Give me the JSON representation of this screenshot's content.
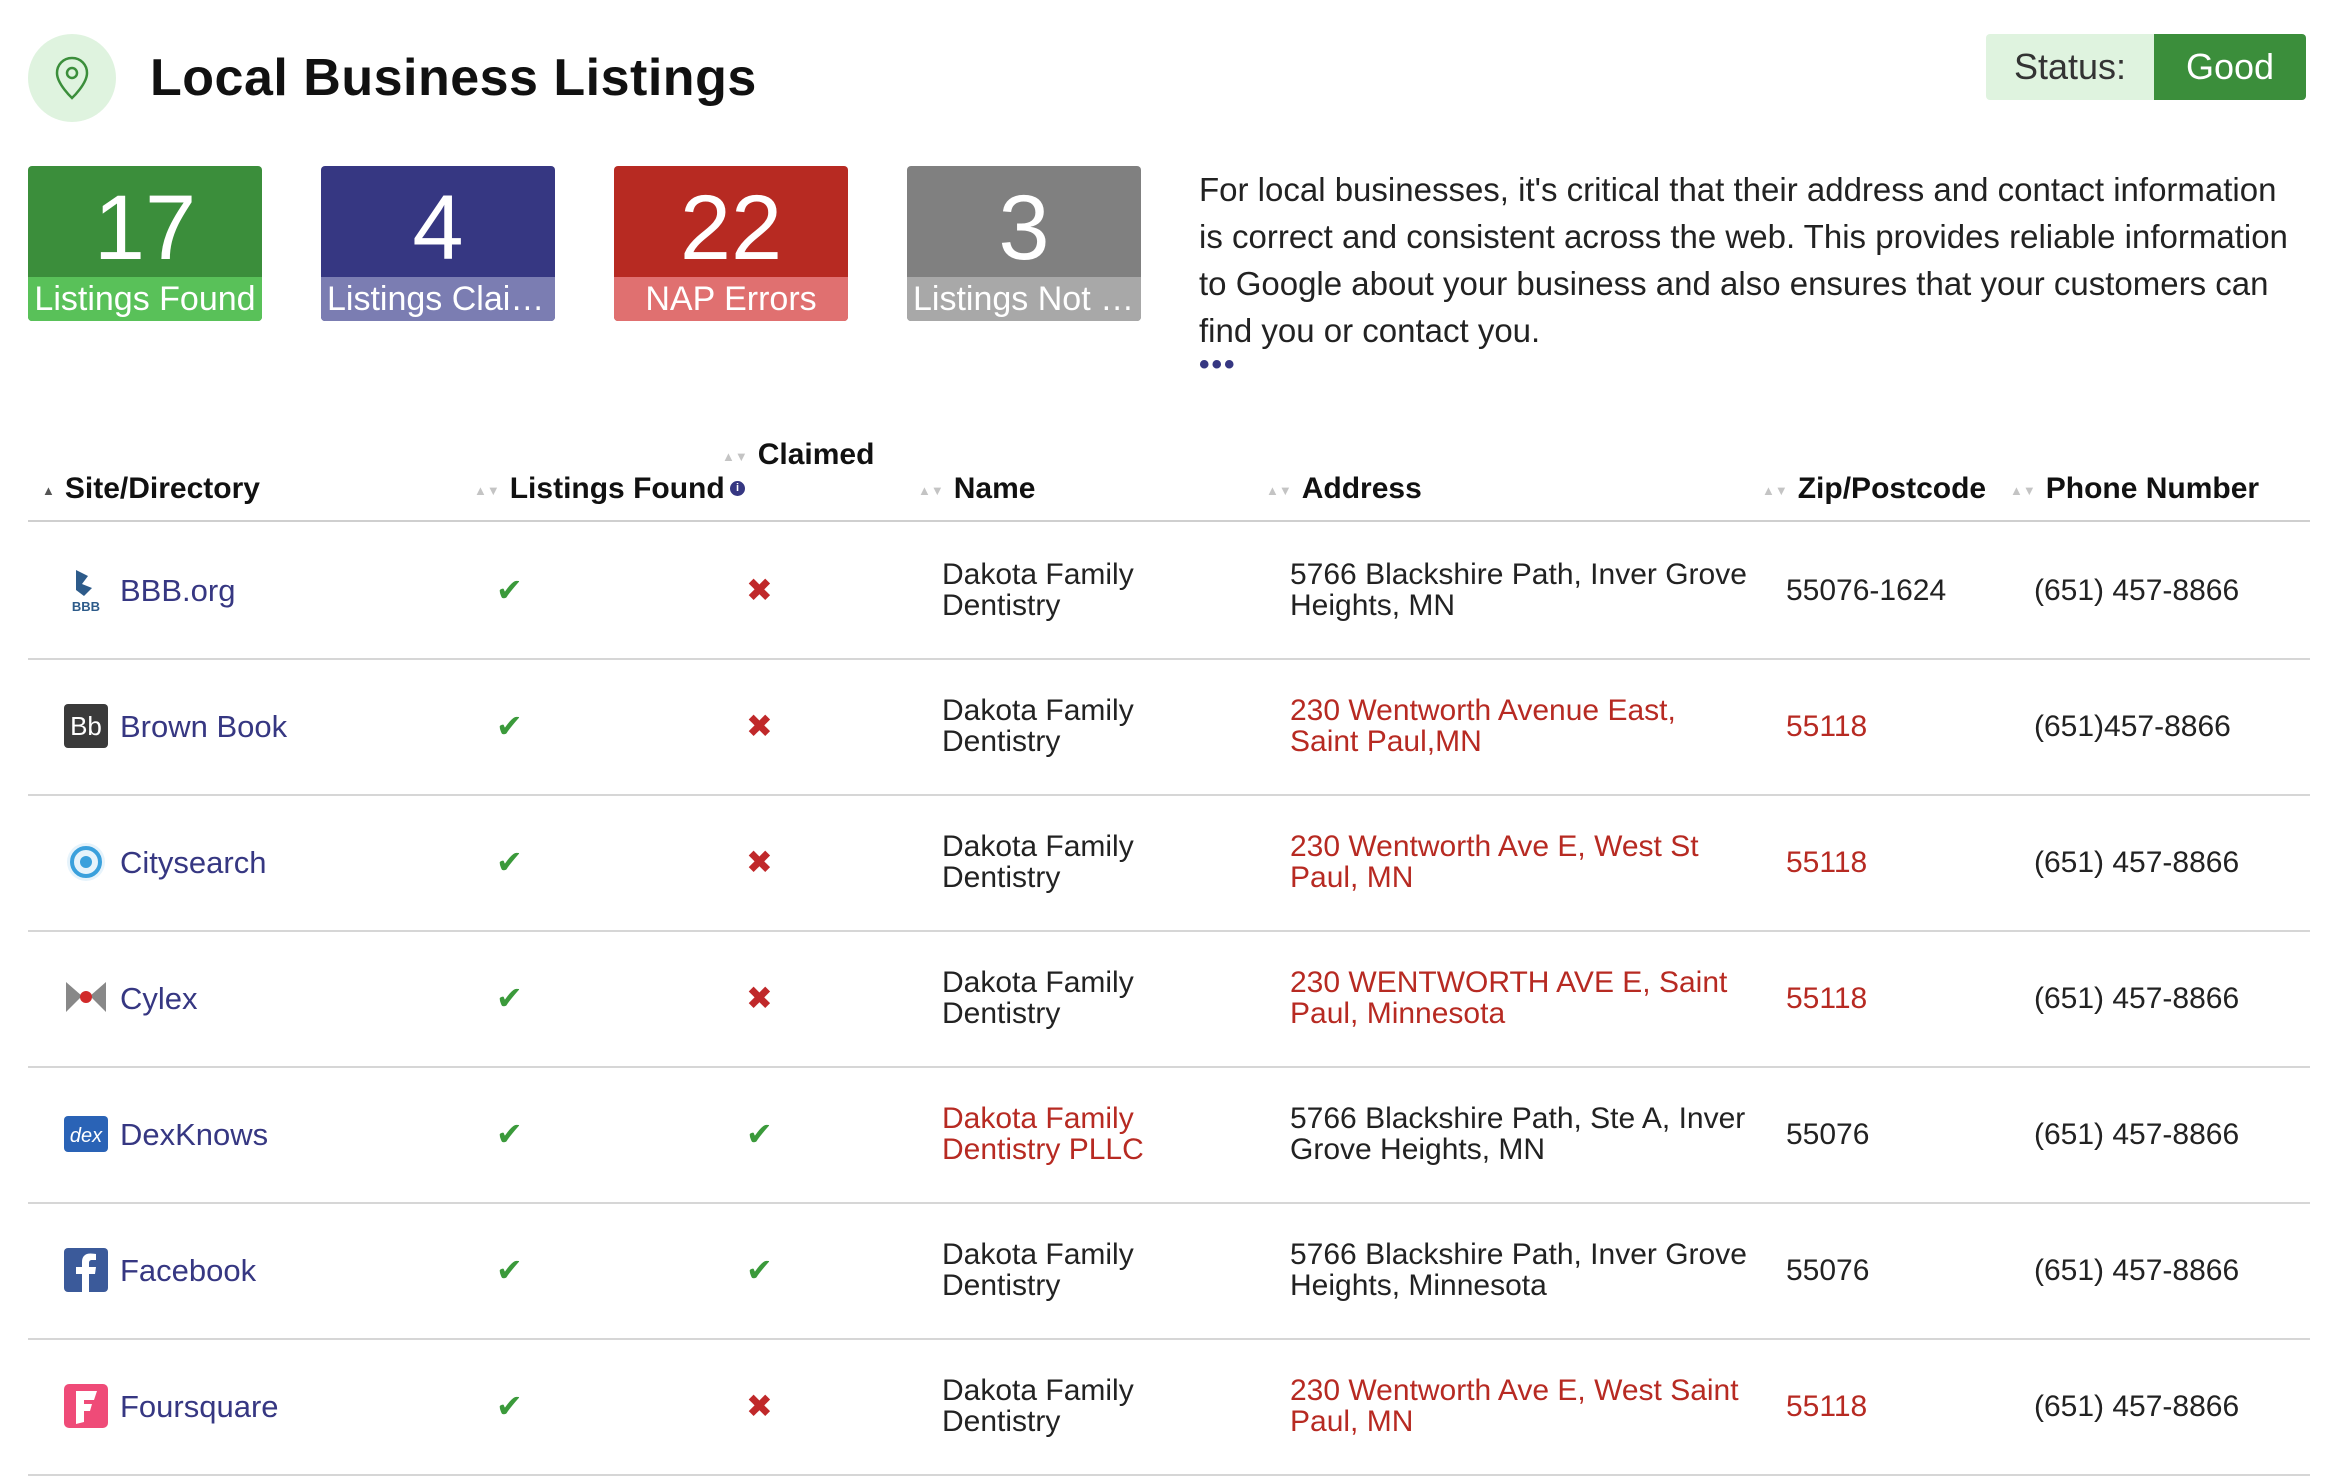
{
  "header": {
    "title": "Local Business Listings",
    "status_label": "Status:",
    "status_value": "Good"
  },
  "stats": [
    {
      "value": "17",
      "label": "Listings Found",
      "color": "#3b8e3b"
    },
    {
      "value": "4",
      "label": "Listings Claimed",
      "color": "#363782"
    },
    {
      "value": "22",
      "label": "NAP Errors",
      "color": "#b72a22"
    },
    {
      "value": "3",
      "label": "Listings Not Found",
      "color": "#808080"
    }
  ],
  "description": "For local businesses, it's critical that their address and contact information is correct and consistent across the web. This provides reliable information to Google about your business and also ensures that your customers can find you or contact you.",
  "more_label": "•••",
  "table": {
    "columns": [
      "Site/Directory",
      "Listings Found",
      "Claimed",
      "Name",
      "Address",
      "Zip/Postcode",
      "Phone Number"
    ],
    "rows": [
      {
        "site": "BBB.org",
        "icon": "bbb-logo-icon",
        "found": "✔",
        "claimed": "✖",
        "claimed_ok": false,
        "name": "Dakota Family Dentistry",
        "name_error": false,
        "address": "5766 Blackshire Path, Inver Grove Heights, MN",
        "address_error": false,
        "zip": "55076-1624",
        "zip_error": false,
        "phone": "(651) 457-8866"
      },
      {
        "site": "Brown Book",
        "icon": "brownbook-logo-icon",
        "found": "✔",
        "claimed": "✖",
        "claimed_ok": false,
        "name": "Dakota Family Dentistry",
        "name_error": false,
        "address": "230 Wentworth Avenue East, Saint Paul,MN",
        "address_error": true,
        "zip": "55118",
        "zip_error": true,
        "phone": "(651)457-8866"
      },
      {
        "site": "Citysearch",
        "icon": "citysearch-logo-icon",
        "found": "✔",
        "claimed": "✖",
        "claimed_ok": false,
        "name": "Dakota Family Dentistry",
        "name_error": false,
        "address": "230 Wentworth Ave E, West St Paul, MN",
        "address_error": true,
        "zip": "55118",
        "zip_error": true,
        "phone": "(651) 457-8866"
      },
      {
        "site": "Cylex",
        "icon": "cylex-logo-icon",
        "found": "✔",
        "claimed": "✖",
        "claimed_ok": false,
        "name": "Dakota Family Dentistry",
        "name_error": false,
        "address": "230 WENTWORTH AVE E, Saint Paul, Minnesota",
        "address_error": true,
        "zip": "55118",
        "zip_error": true,
        "phone": "(651) 457-8866"
      },
      {
        "site": "DexKnows",
        "icon": "dexknows-logo-icon",
        "found": "✔",
        "claimed": "✔",
        "claimed_ok": true,
        "name": "Dakota Family Dentistry PLLC",
        "name_error": true,
        "address": "5766 Blackshire Path, Ste A, Inver Grove Heights, MN",
        "address_error": false,
        "zip": "55076",
        "zip_error": false,
        "phone": "(651) 457-8866"
      },
      {
        "site": "Facebook",
        "icon": "facebook-logo-icon",
        "found": "✔",
        "claimed": "✔",
        "claimed_ok": true,
        "name": "Dakota Family Dentistry",
        "name_error": false,
        "address": "5766 Blackshire Path, Inver Grove Heights, Minnesota",
        "address_error": false,
        "zip": "55076",
        "zip_error": false,
        "phone": "(651) 457-8866"
      },
      {
        "site": "Foursquare",
        "icon": "foursquare-logo-icon",
        "found": "✔",
        "claimed": "✖",
        "claimed_ok": false,
        "name": "Dakota Family Dentistry",
        "name_error": false,
        "address": "230 Wentworth Ave E, West Saint Paul, MN",
        "address_error": true,
        "zip": "55118",
        "zip_error": true,
        "phone": "(651) 457-8866"
      }
    ]
  },
  "colors": {
    "good": "#3b8e3b",
    "error": "#b72a22",
    "link": "#363782"
  }
}
